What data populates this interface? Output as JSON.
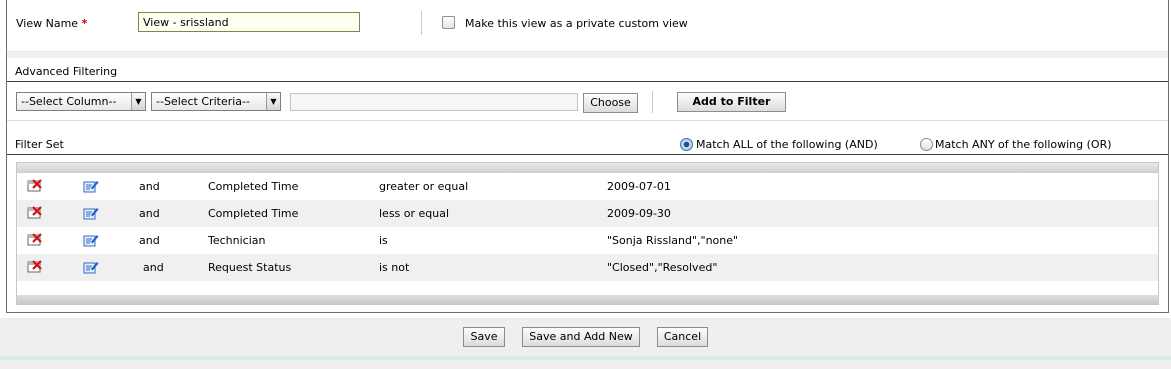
{
  "form": {
    "view_name_label": "View Name",
    "required_mark": "*",
    "view_name_value": "View - srissland",
    "private_checkbox_label": "Make this view as a private custom view",
    "private_checked": false
  },
  "advanced": {
    "title": "Advanced Filtering",
    "select_column": "--Select Column--",
    "select_criteria": "--Select Criteria--",
    "value_text": "",
    "choose_button": "Choose",
    "add_filter_button": "Add to Filter"
  },
  "filterset": {
    "title": "Filter Set",
    "match_all_label": "Match ALL of the following (AND)",
    "match_any_label": "Match ANY of the following (OR)",
    "match_selected": "all",
    "rows": [
      {
        "conj": "and",
        "column": "Completed Time",
        "criteria": "greater or equal",
        "value": "2009-07-01"
      },
      {
        "conj": "and",
        "column": "Completed Time",
        "criteria": "less or equal",
        "value": "2009-09-30"
      },
      {
        "conj": "and",
        "column": "Technician",
        "criteria": "is",
        "value": "\"Sonja Rissland\",\"none\""
      },
      {
        "conj": "and",
        "column": "Request Status",
        "criteria": "is not",
        "value": "\"Closed\",\"Resolved\""
      }
    ]
  },
  "actions": {
    "save": "Save",
    "save_add_new": "Save and Add New",
    "cancel": "Cancel"
  },
  "icons": {
    "delete": "delete-filter-icon",
    "edit": "edit-filter-icon"
  }
}
